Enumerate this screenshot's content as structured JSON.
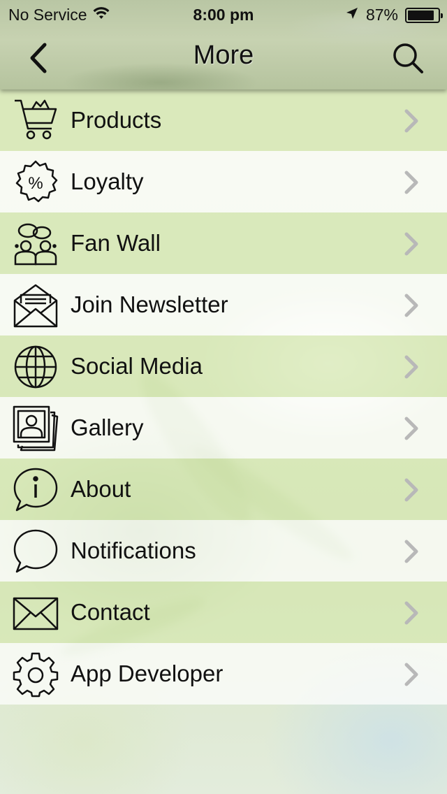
{
  "status_bar": {
    "carrier": "No Service",
    "time": "8:00 pm",
    "battery_percent": "87%",
    "battery_level": 0.87,
    "icons": [
      "wifi-icon",
      "location-arrow-icon",
      "battery-icon"
    ]
  },
  "nav": {
    "title": "More",
    "back_icon": "chevron-left-icon",
    "search_icon": "search-icon"
  },
  "menu": {
    "items": [
      {
        "label": "Products",
        "icon": "shopping-cart-icon"
      },
      {
        "label": "Loyalty",
        "icon": "percent-badge-icon"
      },
      {
        "label": "Fan Wall",
        "icon": "people-chat-icon"
      },
      {
        "label": "Join Newsletter",
        "icon": "open-envelope-icon"
      },
      {
        "label": "Social Media",
        "icon": "globe-icon"
      },
      {
        "label": "Gallery",
        "icon": "photo-stack-icon"
      },
      {
        "label": "About",
        "icon": "info-bubble-icon"
      },
      {
        "label": "Notifications",
        "icon": "speech-bubble-icon"
      },
      {
        "label": "Contact",
        "icon": "envelope-icon"
      },
      {
        "label": "App Developer",
        "icon": "gear-icon"
      }
    ],
    "chevron_icon": "chevron-right-icon"
  },
  "colors": {
    "row_green": "#d6e8b2",
    "row_white": "#ffffff",
    "text": "#111111",
    "chevron": "#b8b8b8"
  }
}
